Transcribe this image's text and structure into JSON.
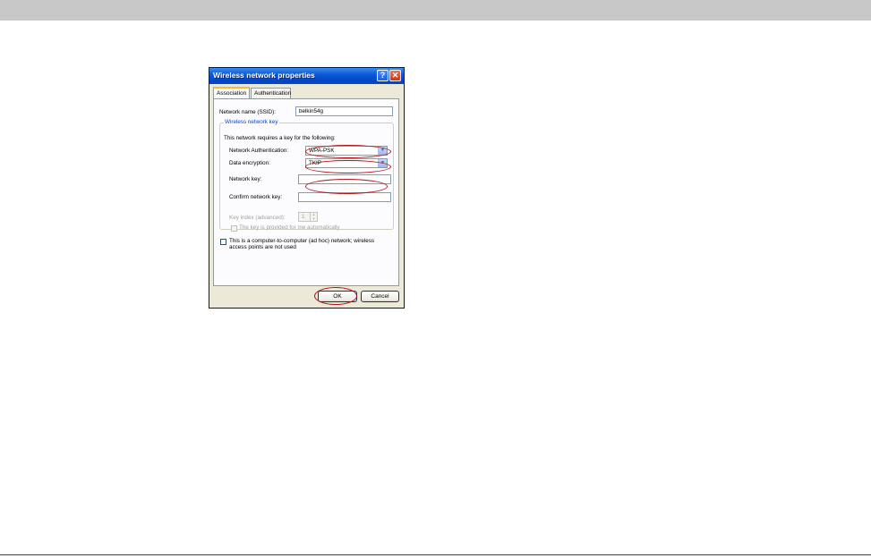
{
  "dialog": {
    "title": "Wireless network properties",
    "help_label": "?",
    "close_label": "✕",
    "tabs": [
      {
        "label": "Association",
        "active": true
      },
      {
        "label": "Authentication",
        "active": false
      }
    ],
    "ssid_label": "Network name (SSID):",
    "ssid_value": "belkin54g",
    "group_title": "Wireless network key",
    "requires_text": "This network requires a key for the following:",
    "auth_label": "Network Authentication:",
    "auth_value": "WPA-PSK",
    "encryption_label": "Data encryption:",
    "encryption_value": "TKIP",
    "key_label": "Network key:",
    "key_value": "",
    "confirm_label": "Confirm network key:",
    "confirm_value": "",
    "key_index_label": "Key index (advanced):",
    "key_index_value": "1",
    "auto_key_label": "The key is provided for me automatically",
    "adhoc_label_line1": "This is a computer-to-computer (ad hoc) network; wireless",
    "adhoc_label_line2": "access points are not used",
    "ok_label": "OK",
    "cancel_label": "Cancel"
  },
  "colors": {
    "highlight": "#b31418",
    "titlebar": "#0a5ad8",
    "top_bar": "#c8c8c8"
  }
}
